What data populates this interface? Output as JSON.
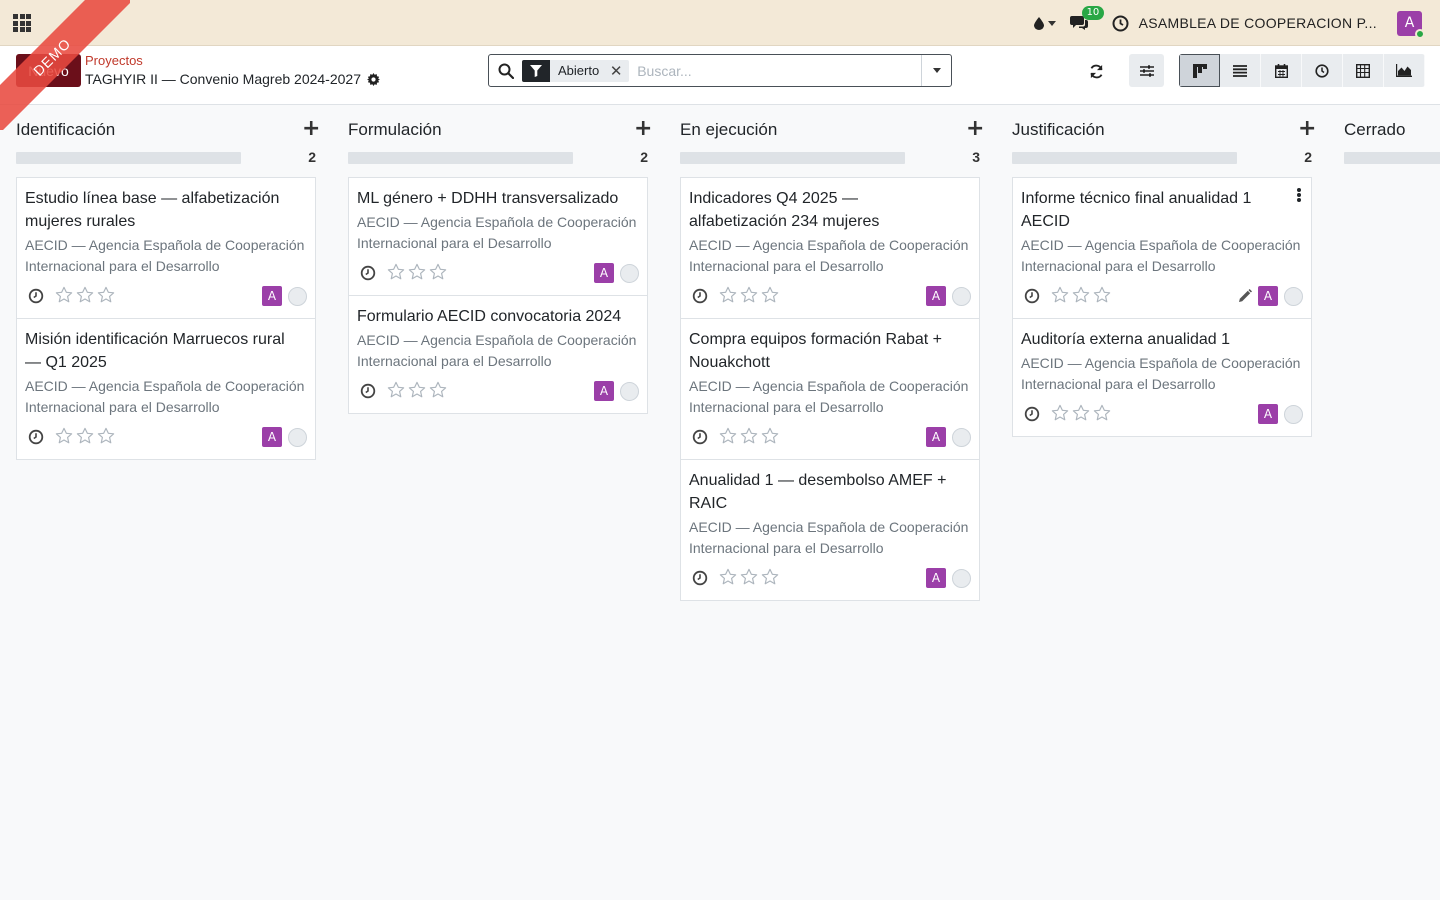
{
  "navbar": {
    "notifications_count": "10",
    "company": "ASAMBLEA DE COOPERACION P...",
    "user_initial": "A"
  },
  "ribbon": "DEMO",
  "control": {
    "new_label": "Nuevo",
    "breadcrumb_parent": "Proyectos",
    "breadcrumb_current": "TAGHYIR II — Convenio Magreb 2024-2027",
    "facet_label": "Abierto",
    "search_placeholder": "Buscar..."
  },
  "colors": {
    "navbar_bg": "#f3e9d7",
    "brand_button": "#6b0f1a",
    "avatar": "#9b3fa8",
    "badge": "#28a745",
    "ribbon": "#e84a40",
    "breadcrumb_link": "#c0392b"
  },
  "columns": [
    {
      "title": "Identificación",
      "count": "2",
      "cards": [
        {
          "title": "Estudio línea base — alfabetización mujeres rurales",
          "partner": "AECID — Agencia Española de Cooperación Internacional para el Desarrollo",
          "avatar": "A"
        },
        {
          "title": "Misión identificación Marruecos rural — Q1 2025",
          "partner": "AECID — Agencia Española de Cooperación Internacional para el Desarrollo",
          "avatar": "A"
        }
      ]
    },
    {
      "title": "Formulación",
      "count": "2",
      "cards": [
        {
          "title": "ML género + DDHH transversalizado",
          "partner": "AECID — Agencia Española de Cooperación Internacional para el Desarrollo",
          "avatar": "A"
        },
        {
          "title": "Formulario AECID convocatoria 2024",
          "partner": "AECID — Agencia Española de Cooperación Internacional para el Desarrollo",
          "avatar": "A"
        }
      ]
    },
    {
      "title": "En ejecución",
      "count": "3",
      "cards": [
        {
          "title": "Indicadores Q4 2025 — alfabetización 234 mujeres",
          "partner": "AECID — Agencia Española de Cooperación Internacional para el Desarrollo",
          "avatar": "A"
        },
        {
          "title": "Compra equipos formación Rabat + Nouakchott",
          "partner": "AECID — Agencia Española de Cooperación Internacional para el Desarrollo",
          "avatar": "A"
        },
        {
          "title": "Anualidad 1 — desembolso AMEF + RAIC",
          "partner": "AECID — Agencia Española de Cooperación Internacional para el Desarrollo",
          "avatar": "A"
        }
      ]
    },
    {
      "title": "Justificación",
      "count": "2",
      "cards": [
        {
          "title": "Informe técnico final anualidad 1 AECID",
          "partner": "AECID — Agencia Española de Cooperación Internacional para el Desarrollo",
          "avatar": "A"
        },
        {
          "title": "Auditoría externa anualidad 1",
          "partner": "AECID — Agencia Española de Cooperación Internacional para el Desarrollo",
          "avatar": "A"
        }
      ]
    },
    {
      "title": "Cerrado",
      "count": "",
      "cards": []
    }
  ]
}
